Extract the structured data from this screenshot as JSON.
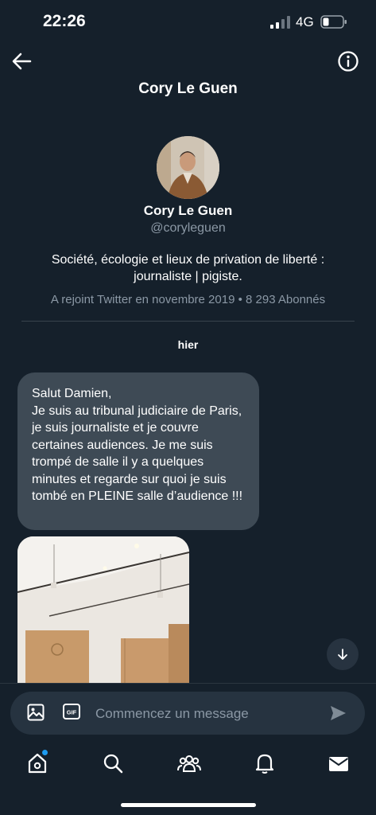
{
  "status_bar": {
    "time": "22:26",
    "network": "4G"
  },
  "header": {
    "title": "Cory Le Guen"
  },
  "profile": {
    "name": "Cory Le Guen",
    "handle": "@coryleguen",
    "bio": "Société, écologie et lieux de privation de liberté : journaliste | pigiste.",
    "meta": "A rejoint Twitter en novembre 2019 • 8 293 Abonnés"
  },
  "conversation": {
    "day_label": "hier",
    "messages": [
      {
        "text": "Salut Damien,\nJe suis au tribunal judiciaire de Paris, je suis journaliste et je couvre certaines audiences. Je me suis trompé de salle il y a quelques minutes et regarde sur quoi je suis tombé en PLEINE salle d’audience !!!"
      }
    ]
  },
  "composer": {
    "placeholder": "Commencez un message"
  },
  "nav": {
    "items": [
      "home-icon",
      "search-icon",
      "communities-icon",
      "notifications-icon",
      "messages-icon"
    ]
  },
  "colors": {
    "background": "#15202b",
    "bubble": "#3e4a55",
    "accent": "#1d9bf0",
    "secondary_text": "#8b98a5"
  }
}
